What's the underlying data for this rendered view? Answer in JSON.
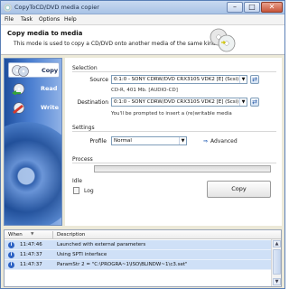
{
  "window": {
    "title": "CopyToCD/DVD media copier"
  },
  "menu": [
    "File",
    "Task",
    "Options",
    "Help"
  ],
  "banner": {
    "title": "Copy media to media",
    "description": "This mode is used to copy a CD/DVD onto another media of the same kind"
  },
  "nav": [
    {
      "label": "Copy",
      "icon": "copy-disc-icon",
      "active": true
    },
    {
      "label": "Read",
      "icon": "read-disc-icon",
      "active": false
    },
    {
      "label": "Write",
      "icon": "write-disc-icon",
      "active": false
    }
  ],
  "selection": {
    "heading": "Selection",
    "source_label": "Source",
    "source_value": "0:1:0 - SONY CDRW/DVD CRX310S VDK2 [E] (Scsi)",
    "source_info": "CD-R, 401 Mb. [AUDIO-CD]",
    "destination_label": "Destination",
    "destination_value": "0:1:0 - SONY CDRW/DVD CRX310S VDK2 [E] (Scsi)",
    "destination_info": "You'll be prompted to insert a (re)writable media"
  },
  "settings": {
    "heading": "Settings",
    "profile_label": "Profile",
    "profile_value": "Normal",
    "advanced_label": "Advanced"
  },
  "process": {
    "heading": "Process",
    "progress": 0,
    "status": "Idle",
    "log_label": "Log",
    "copy_button": "Copy"
  },
  "log": {
    "columns": [
      "When",
      "Description"
    ],
    "rows": [
      {
        "time": "11:47:46",
        "desc": "Launched with external parameters"
      },
      {
        "time": "11:47:37",
        "desc": "Using SPTI interface"
      },
      {
        "time": "11:47:37",
        "desc": "ParamStr 2 = \"C:\\PROGRA~1\\ISO\\BLINDW~1\\c3.set\""
      }
    ]
  },
  "colors": {
    "accent": "#2e63c4",
    "sidebar": "#3b6fc2",
    "log_highlight": "#cfe0f7"
  }
}
